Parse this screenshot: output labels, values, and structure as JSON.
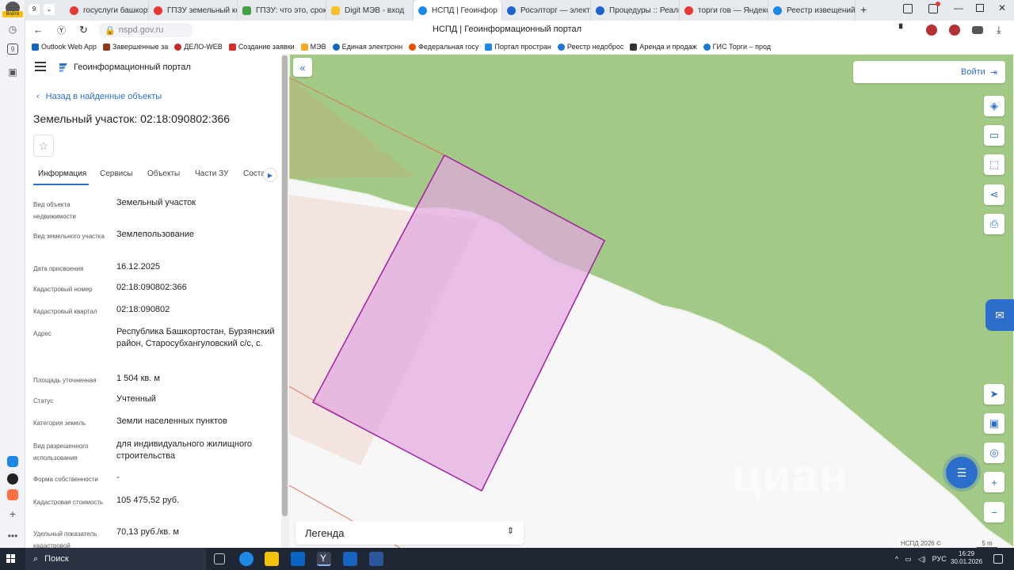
{
  "browser": {
    "profile_label": "Войти",
    "tab_count": "9",
    "tabs": [
      {
        "title": "госуслуги башкорто",
        "color": "#e53935"
      },
      {
        "title": "ГПЗУ земельный ко",
        "color": "#e53935"
      },
      {
        "title": "ГПЗУ: что это, срок",
        "color": "#43a047"
      },
      {
        "title": "Digit МЭВ - вход",
        "color": "#fbc02d"
      },
      {
        "title": "НСПД | Геоинфор",
        "color": "#1e88e5"
      },
      {
        "title": "Росэлторг — электр",
        "color": "#1e63c8"
      },
      {
        "title": "Процедуры :: Реали",
        "color": "#1e63c8"
      },
      {
        "title": "торги гов — Яндекс",
        "color": "#e53935"
      },
      {
        "title": "Реестр извещений",
        "color": "#1e88e5"
      }
    ],
    "url": "nspd.gov.ru",
    "page_title": "НСПД | Геоинформационный портал",
    "bookmarks": [
      {
        "label": "Outlook Web App",
        "color": "#1565c0"
      },
      {
        "label": "Завершенные за",
        "color": "#8d3b1f"
      },
      {
        "label": "ДЕЛО-WEB",
        "color": "#c62828"
      },
      {
        "label": "Создание заявки",
        "color": "#d32f2f"
      },
      {
        "label": "МЭВ",
        "color": "#f9a825"
      },
      {
        "label": "Единая электронн",
        "color": "#1565c0"
      },
      {
        "label": "Федеральная госу",
        "color": "#e65100"
      },
      {
        "label": "Портал простран",
        "color": "#1e88e5"
      },
      {
        "label": "Реестр недоброс",
        "color": "#1976d2"
      },
      {
        "label": "Аренда и продаж",
        "color": "#333333"
      },
      {
        "label": "ГИС Торги – прод",
        "color": "#1976d2"
      }
    ]
  },
  "panel": {
    "portal_name": "Геоинформационный портал",
    "back_label": "Назад в найденные объекты",
    "title": "Земельный участок: 02:18:090802:366",
    "tabs": [
      "Информация",
      "Сервисы",
      "Объекты",
      "Части ЗУ",
      "Соста"
    ],
    "fields": [
      {
        "key": "Вид объекта недвижимости",
        "value": "Земельный участок"
      },
      {
        "key": "Вид земельного участка",
        "value": "Землепользование"
      },
      {
        "key": "Дата присвоения",
        "value": "16.12.2025"
      },
      {
        "key": "Кадастровый номер",
        "value": "02:18:090802:366"
      },
      {
        "key": "Кадастровый квартал",
        "value": "02:18:090802"
      },
      {
        "key": "Адрес",
        "value": "Республика Башкортостан, Бурзянский район, Старосубхангуловский с/с, с."
      },
      {
        "key": "Площадь уточненная",
        "value": "1 504 кв. м"
      },
      {
        "key": "Статус",
        "value": "Учтенный"
      },
      {
        "key": "Категория земель",
        "value": "Земли населенных пунктов"
      },
      {
        "key": "Вид разрешенного использования",
        "value": "для индивидуального жилищного строительства"
      },
      {
        "key": "Форма собственности",
        "value": "-"
      },
      {
        "key": "Кадастровая стоимость",
        "value": "105 475,52 руб."
      },
      {
        "key": "Удельный показатель кадастровой",
        "value": "70,13 руб./кв. м"
      }
    ]
  },
  "map": {
    "login_label": "Войти",
    "legend_label": "Легенда",
    "watermark": "циан",
    "copyright": "НСПД 2026 ©",
    "scale_label": "5 m"
  },
  "taskbar": {
    "search_label": "Поиск",
    "lang": "РУС",
    "time": "16:29",
    "date": "30.01.2026"
  }
}
